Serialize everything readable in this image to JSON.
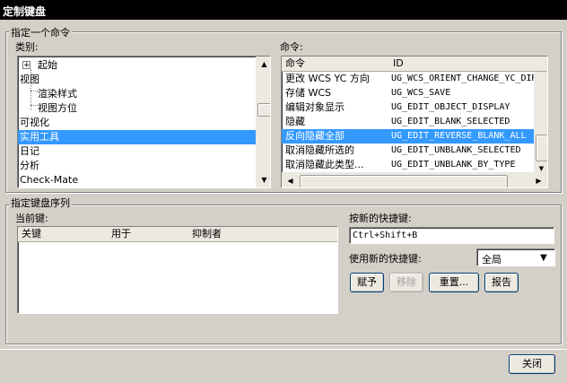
{
  "window": {
    "title": "定制键盘"
  },
  "group_specify_command": {
    "legend": "指定一个命令",
    "category_label": "类别:",
    "categories": [
      {
        "label": "起始",
        "expander": "+"
      },
      {
        "label": "视图"
      },
      {
        "label": "渲染样式"
      },
      {
        "label": "视图方位"
      },
      {
        "label": "可视化"
      },
      {
        "label": "实用工具",
        "selected": true
      },
      {
        "label": "日记"
      },
      {
        "label": "分析"
      },
      {
        "label": "Check-Mate"
      }
    ],
    "command_label": "命令:",
    "command_columns": [
      "命令",
      "ID"
    ],
    "commands": [
      {
        "name": "更改 WCS YC 方向",
        "id": "UG_WCS_ORIENT_CHANGE_YC_DIR"
      },
      {
        "name": "存储 WCS",
        "id": "UG_WCS_SAVE"
      },
      {
        "name": "编辑对象显示",
        "id": "UG_EDIT_OBJECT_DISPLAY"
      },
      {
        "name": "隐藏",
        "id": "UG_EDIT_BLANK_SELECTED"
      },
      {
        "name": "反向隐藏全部",
        "id": "UG_EDIT_REVERSE_BLANK_ALL",
        "selected": true
      },
      {
        "name": "取消隐藏所选的",
        "id": "UG_EDIT_UNBLANK_SELECTED"
      },
      {
        "name": "取消隐藏此类型...",
        "id": "UG_EDIT_UNBLANK_BY_TYPE"
      }
    ]
  },
  "group_key_sequence": {
    "legend": "指定键盘序列",
    "current_keys_label": "当前键:",
    "current_keys_columns": [
      "关键",
      "用于",
      "抑制者"
    ],
    "new_shortcut_label": "按新的快捷键:",
    "new_shortcut_value": "Ctrl+Shift+B",
    "use_new_shortcut_label": "使用新的快捷键:",
    "scope_value": "全局",
    "buttons": {
      "assign": "赋予",
      "remove": "移除",
      "reset": "重置...",
      "report": "报告"
    }
  },
  "footer": {
    "close": "关闭"
  },
  "colors": {
    "selection": "#3399ff",
    "dialog_bg": "#d4d0c8"
  }
}
